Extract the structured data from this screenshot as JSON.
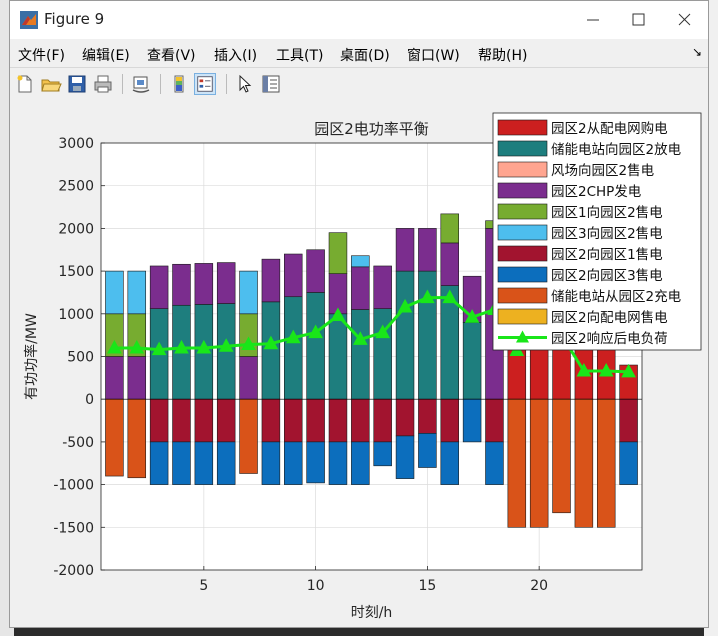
{
  "window": {
    "title": "Figure 9",
    "menus": [
      "文件(F)",
      "编辑(E)",
      "查看(V)",
      "插入(I)",
      "工具(T)",
      "桌面(D)",
      "窗口(W)",
      "帮助(H)"
    ]
  },
  "toolbar": {
    "icons": [
      "new-figure-icon",
      "open-file-icon",
      "save-icon",
      "print-icon",
      "link-plot-icon",
      "colorbar-icon",
      "legend-icon",
      "pointer-icon",
      "property-inspector-icon"
    ]
  },
  "chart_data": {
    "type": "bar",
    "title": "园区2电功率平衡",
    "xlabel": "时刻/h",
    "ylabel": "有功功率/MW",
    "xlim": [
      0.4,
      24.6
    ],
    "ylim": [
      -2000,
      3000
    ],
    "xticks": [
      5,
      10,
      15,
      20
    ],
    "yticks": [
      -2000,
      -1500,
      -1000,
      -500,
      0,
      500,
      1000,
      1500,
      2000,
      2500,
      3000
    ],
    "grid": true,
    "legend_position": "top-right",
    "categories": [
      1,
      2,
      3,
      4,
      5,
      6,
      7,
      8,
      9,
      10,
      11,
      12,
      13,
      14,
      15,
      16,
      17,
      18,
      19,
      20,
      21,
      22,
      23,
      24
    ],
    "series": [
      {
        "name": "园区2从配电网购电",
        "color": "#cc1f1f",
        "values": [
          0,
          0,
          0,
          0,
          0,
          0,
          0,
          0,
          0,
          0,
          0,
          0,
          0,
          0,
          0,
          0,
          0,
          0,
          1000,
          1600,
          1050,
          800,
          600,
          400
        ]
      },
      {
        "name": "储能电站向园区2放电",
        "color": "#1e7e7e",
        "values": [
          0,
          0,
          1060,
          1100,
          1110,
          1120,
          0,
          1140,
          1200,
          1250,
          1000,
          1050,
          1060,
          1500,
          1500,
          1330,
          900,
          0,
          0,
          0,
          0,
          0,
          0,
          0
        ]
      },
      {
        "name": "风场向园区2售电",
        "color": "#ffa590",
        "values": [
          0,
          0,
          0,
          0,
          0,
          0,
          0,
          0,
          0,
          0,
          0,
          0,
          0,
          0,
          0,
          0,
          0,
          0,
          0,
          0,
          0,
          0,
          0,
          0
        ]
      },
      {
        "name": "园区2CHP发电",
        "color": "#7b2d8e",
        "values": [
          500,
          500,
          500,
          480,
          480,
          480,
          500,
          500,
          500,
          500,
          470,
          500,
          500,
          500,
          500,
          500,
          540,
          2000,
          0,
          0,
          0,
          0,
          0,
          0
        ]
      },
      {
        "name": "园区1向园区2售电",
        "color": "#77ac30",
        "values": [
          500,
          500,
          0,
          0,
          0,
          0,
          500,
          0,
          0,
          0,
          480,
          0,
          0,
          0,
          0,
          340,
          0,
          90,
          0,
          0,
          0,
          0,
          0,
          0
        ]
      },
      {
        "name": "园区3向园区2售电",
        "color": "#4dbeee",
        "values": [
          500,
          500,
          0,
          0,
          0,
          0,
          500,
          0,
          0,
          0,
          0,
          130,
          0,
          0,
          0,
          0,
          0,
          0,
          0,
          0,
          0,
          0,
          0,
          0
        ]
      },
      {
        "name": "园区2向园区1售电",
        "color": "#a2142f",
        "values": [
          0,
          0,
          -500,
          -500,
          -500,
          -500,
          0,
          -500,
          -500,
          -500,
          -500,
          -500,
          -500,
          -430,
          -400,
          -500,
          0,
          -500,
          0,
          0,
          0,
          0,
          0,
          -500
        ]
      },
      {
        "name": "园区2向园区3售电",
        "color": "#0c6ebd",
        "values": [
          0,
          0,
          -500,
          -500,
          -500,
          -500,
          0,
          -500,
          -500,
          -480,
          -500,
          -500,
          -280,
          -500,
          -400,
          -500,
          -500,
          -500,
          0,
          0,
          0,
          0,
          0,
          -500
        ]
      },
      {
        "name": "储能电站从园区2充电",
        "color": "#d95319",
        "values": [
          -900,
          -920,
          0,
          0,
          0,
          0,
          -870,
          0,
          0,
          0,
          0,
          0,
          0,
          0,
          0,
          0,
          0,
          0,
          -1500,
          -1500,
          -1330,
          -1500,
          -1500,
          0
        ]
      },
      {
        "name": "园区2向配电网售电",
        "color": "#edb120",
        "values": [
          0,
          0,
          0,
          0,
          0,
          0,
          0,
          0,
          0,
          0,
          0,
          0,
          0,
          0,
          0,
          0,
          0,
          0,
          0,
          0,
          0,
          0,
          0,
          0
        ]
      }
    ],
    "line_series": {
      "name": "园区2响应后电负荷",
      "color": "#19e619",
      "values": [
        600,
        600,
        580,
        600,
        600,
        620,
        640,
        650,
        720,
        780,
        980,
        700,
        780,
        1080,
        1190,
        1190,
        960,
        1050,
        570,
        1000,
        750,
        330,
        330,
        320
      ]
    }
  }
}
